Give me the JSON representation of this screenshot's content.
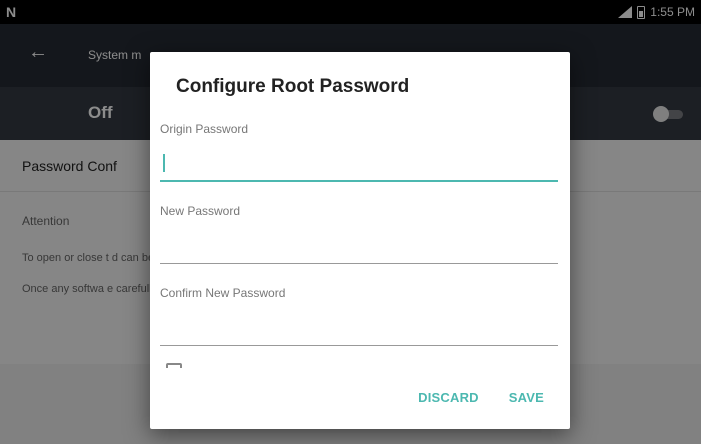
{
  "status_bar": {
    "time": "1:55 PM",
    "notification_icon": "N"
  },
  "app_bar": {
    "back_icon": "←",
    "title": "System m"
  },
  "toggle_row": {
    "state_label": "Off"
  },
  "section": {
    "title": "Password Conf"
  },
  "content": {
    "attention": "Attention",
    "paragraph1": "To open or close t                                                                                                   d can be changed by clicking the Pa",
    "paragraph2": "Once any softwa                                                                                                     e carefully whether to open s"
  },
  "dialog": {
    "title": "Configure Root Password",
    "fields": [
      {
        "label": "Origin Password",
        "value": "",
        "focused": true
      },
      {
        "label": "New Password",
        "value": ""
      },
      {
        "label": "Confirm New Password",
        "value": ""
      }
    ],
    "discard_label": "DISCARD",
    "save_label": "SAVE"
  },
  "colors": {
    "accent": "#4cb8b0",
    "app_bar": "#262b33",
    "toggle_row": "#343a43"
  }
}
